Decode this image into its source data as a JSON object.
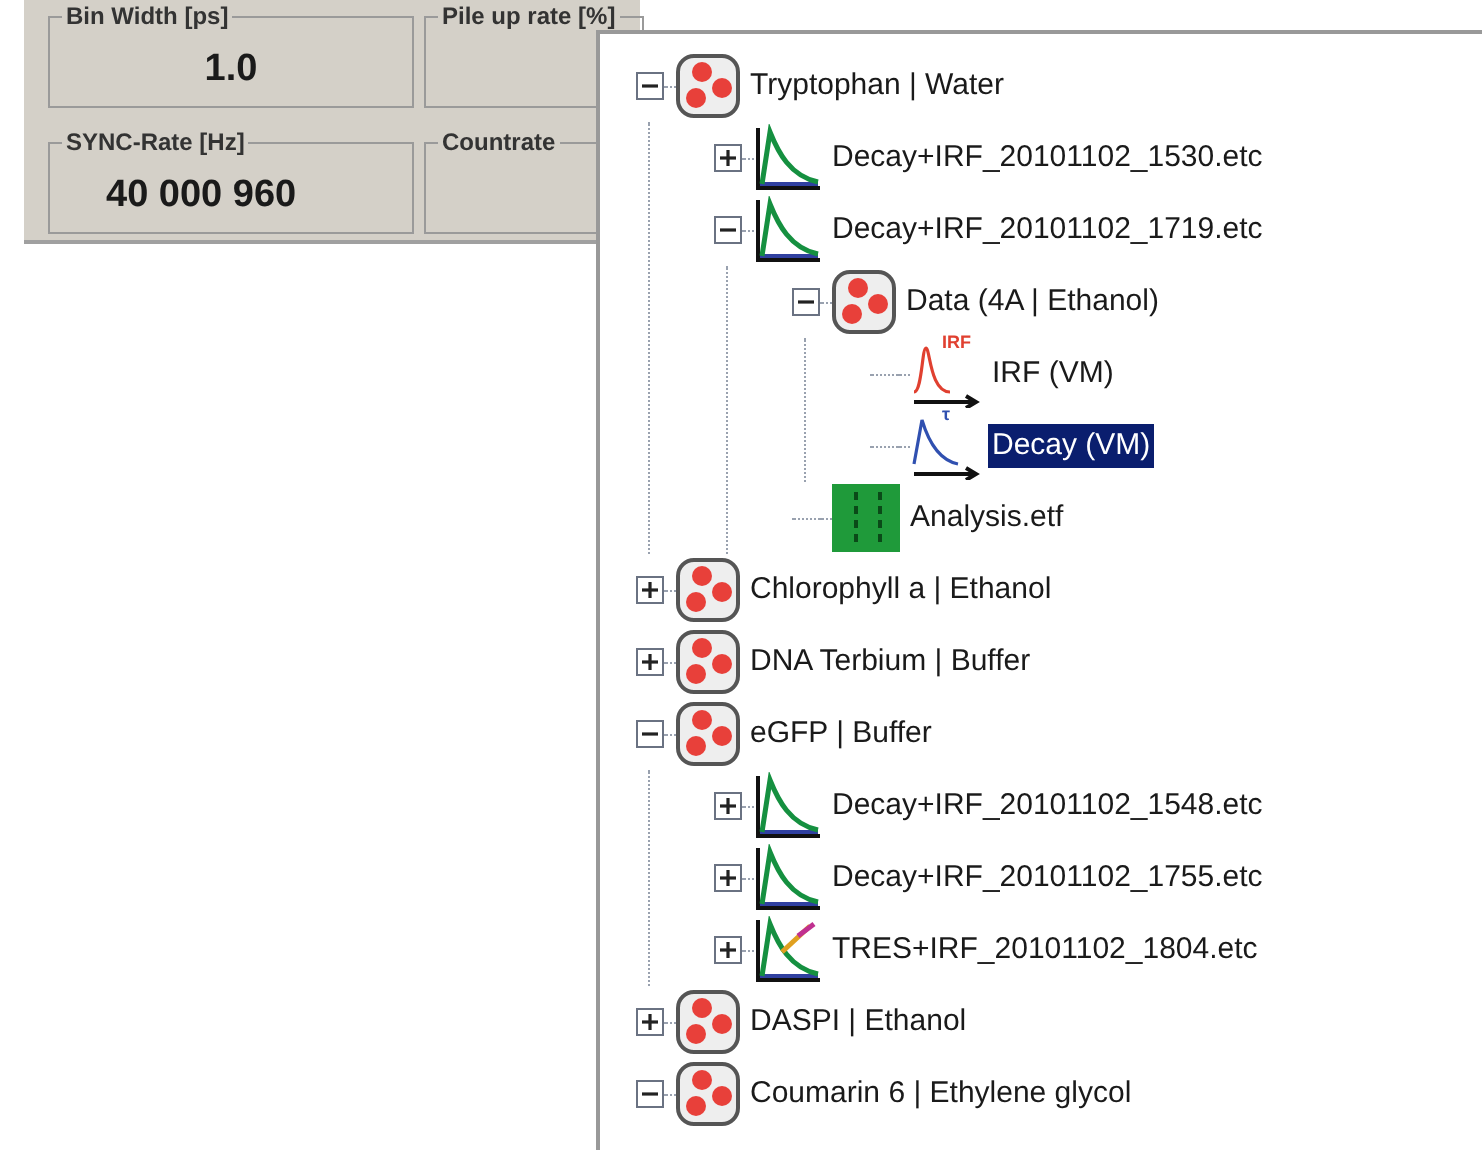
{
  "settings_panel": {
    "groups": [
      {
        "label": "Bin Width [ps]",
        "value": "1.0"
      },
      {
        "label": "Pile up rate [%]"
      },
      {
        "label": "SYNC-Rate  [Hz]",
        "value": "40 000 960"
      },
      {
        "label": "Countrate"
      }
    ]
  },
  "tree": [
    {
      "kind": "sample",
      "label": "Tryptophan | Water",
      "expanded": true,
      "selected": false,
      "children": [
        {
          "kind": "decay",
          "label": "Decay+IRF_20101102_1530.etc",
          "expanded": false,
          "selected": false
        },
        {
          "kind": "decay",
          "label": "Decay+IRF_20101102_1719.etc",
          "expanded": true,
          "selected": false,
          "children": [
            {
              "kind": "sample",
              "label": "Data (4A | Ethanol)",
              "expanded": true,
              "selected": false,
              "children": [
                {
                  "kind": "irf",
                  "label": "IRF (VM)",
                  "badge": "IRF",
                  "selected": false
                },
                {
                  "kind": "curve",
                  "label": "Decay (VM)",
                  "badge": "τ",
                  "selected": true
                }
              ]
            },
            {
              "kind": "analysis",
              "label": "Analysis.etf",
              "selected": false
            }
          ]
        }
      ]
    },
    {
      "kind": "sample",
      "label": "Chlorophyll a | Ethanol",
      "expanded": false,
      "selected": false
    },
    {
      "kind": "sample",
      "label": "DNA Terbium | Buffer",
      "expanded": false,
      "selected": false
    },
    {
      "kind": "sample",
      "label": "eGFP | Buffer",
      "expanded": true,
      "selected": false,
      "children": [
        {
          "kind": "decay",
          "label": "Decay+IRF_20101102_1548.etc",
          "expanded": false,
          "selected": false
        },
        {
          "kind": "decay",
          "label": "Decay+IRF_20101102_1755.etc",
          "expanded": false,
          "selected": false
        },
        {
          "kind": "tres",
          "label": "TRES+IRF_20101102_1804.etc",
          "expanded": false,
          "selected": false
        }
      ]
    },
    {
      "kind": "sample",
      "label": "DASPI | Ethanol",
      "expanded": false,
      "selected": false
    },
    {
      "kind": "sample",
      "label": "Coumarin 6 | Ethylene glycol",
      "expanded": true,
      "selected": false
    }
  ]
}
